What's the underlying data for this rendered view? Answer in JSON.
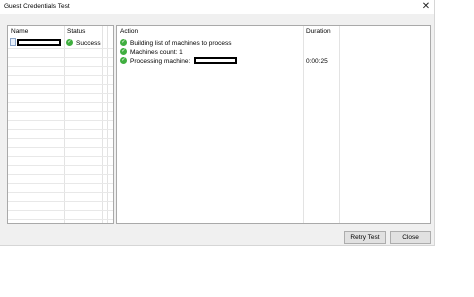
{
  "window": {
    "title": "Guest Credentials Test"
  },
  "left_table": {
    "columns": [
      "Name",
      "Status"
    ],
    "rows": [
      {
        "status": "Success"
      }
    ]
  },
  "right_table": {
    "columns": [
      "Action",
      "Duration"
    ],
    "rows": [
      {
        "action": "Building list of machines to process",
        "duration": ""
      },
      {
        "action": "Machines count: 1",
        "duration": ""
      },
      {
        "action": "Processing machine:",
        "duration": "0:00:25"
      }
    ]
  },
  "buttons": {
    "retry": "Retry Test",
    "close": "Close"
  },
  "icons": {
    "status": "check-circle-icon",
    "close": "close-icon",
    "sort": "sort-up-icon",
    "file": "file-icon"
  },
  "colors": {
    "success": "#3fae3f",
    "border": "#a9a9a9",
    "background": "#f0f0f0"
  }
}
